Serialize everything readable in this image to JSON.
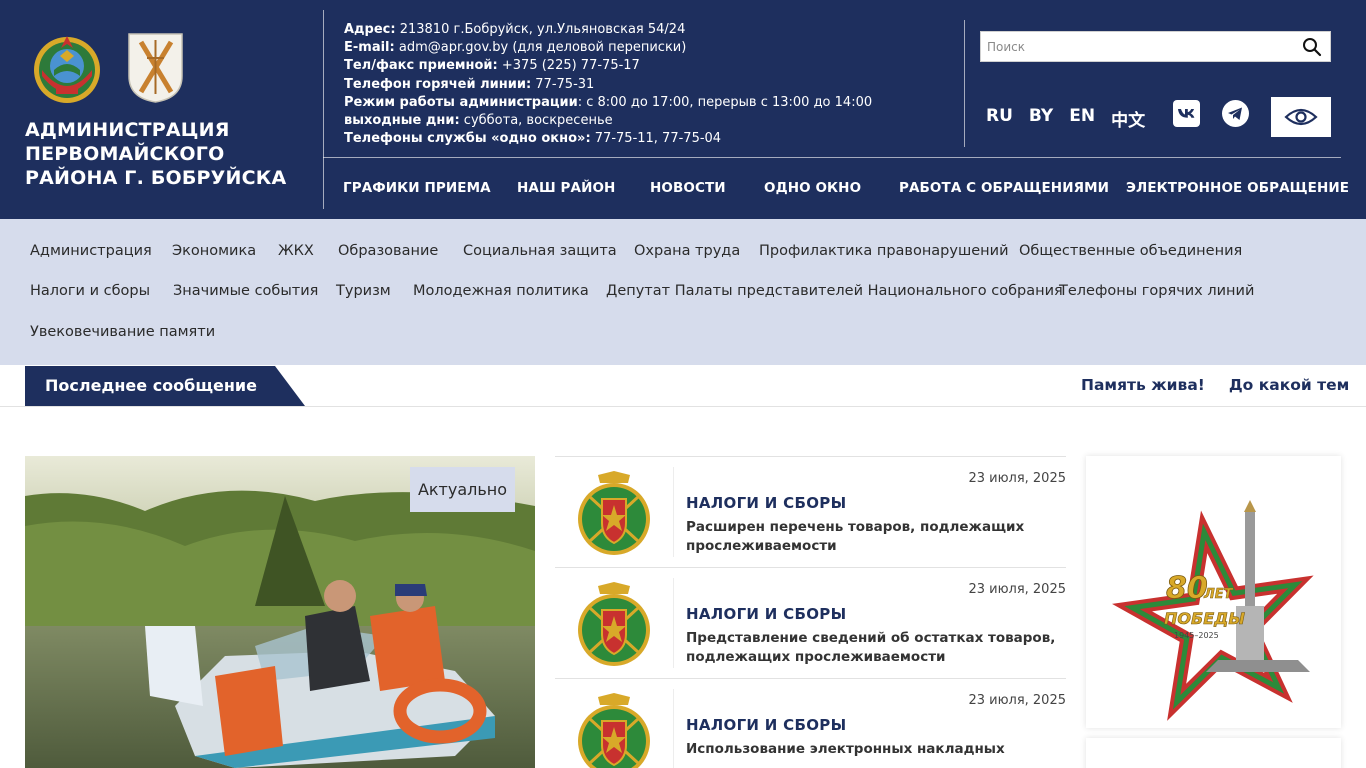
{
  "header": {
    "org_name": "АДМИНИСТРАЦИЯ ПЕРВОМАЙСКОГО РАЙОНА Г. БОБРУЙСКА",
    "contacts": [
      {
        "label": "Адрес:",
        "value": " 213810 г.Бобруйск, ул.Ульяновская 54/24"
      },
      {
        "label": "E-mail:",
        "value": " adm@apr.gov.by (для деловой переписки)"
      },
      {
        "label": "Тел/факс приемной:",
        "value": " +375 (225) 77-75-17"
      },
      {
        "label": "Телефон горячей линии:",
        "value": " 77-75-31"
      },
      {
        "label": "Режим работы администрации",
        "value": ": с 8:00 до 17:00, перерыв с 13:00 до 14:00"
      },
      {
        "label": "выходные дни:",
        "value": " суббота, воскресенье"
      },
      {
        "label": "Телефоны службы «одно окно»:",
        "value": " 77-75-11, 77-75-04"
      }
    ],
    "search_placeholder": "Поиск",
    "languages": [
      "RU",
      "BY",
      "EN",
      "中文"
    ],
    "nav": [
      "ГРАФИКИ ПРИЕМА",
      "НАШ РАЙОН",
      "НОВОСТИ",
      "ОДНО ОКНО",
      "РАБОТА С ОБРАЩЕНИЯМИ",
      "ЭЛЕКТРОННОЕ ОБРАЩЕНИЕ"
    ]
  },
  "section_nav": [
    "Администрация",
    "Экономика",
    "ЖКХ",
    "Образование",
    "Социальная защита",
    "Охрана труда",
    "Профилактика правонарушений",
    "Общественные объединения",
    "Налоги и сборы",
    "Значимые события",
    "Туризм",
    "Молодежная политика",
    "Депутат Палаты представителей Национального собрания",
    "Телефоны горячих линий",
    "Увековечивание памяти"
  ],
  "ticker": {
    "label": "Последнее сообщение",
    "items": [
      "Память жива!",
      "До какой тем"
    ]
  },
  "feature": {
    "badge": "Актуально"
  },
  "news": [
    {
      "date": "23 июля, 2025",
      "category": "НАЛОГИ И СБОРЫ",
      "title": "Расширен перечень товаров, подлежащих прослеживаемости"
    },
    {
      "date": "23 июля, 2025",
      "category": "НАЛОГИ И СБОРЫ",
      "title": "Представление сведений об остатках товаров, подлежащих прослеживаемости"
    },
    {
      "date": "23 июля, 2025",
      "category": "НАЛОГИ И СБОРЫ",
      "title": "Использование электронных накладных"
    }
  ],
  "banner": {
    "line1": "80",
    "line2": "ЛЕТ",
    "line3": "ПОБЕДЫ",
    "years": "1945–2025"
  },
  "colors": {
    "brand_dark": "#1e2f5e",
    "section_bg": "#d6dcec"
  }
}
